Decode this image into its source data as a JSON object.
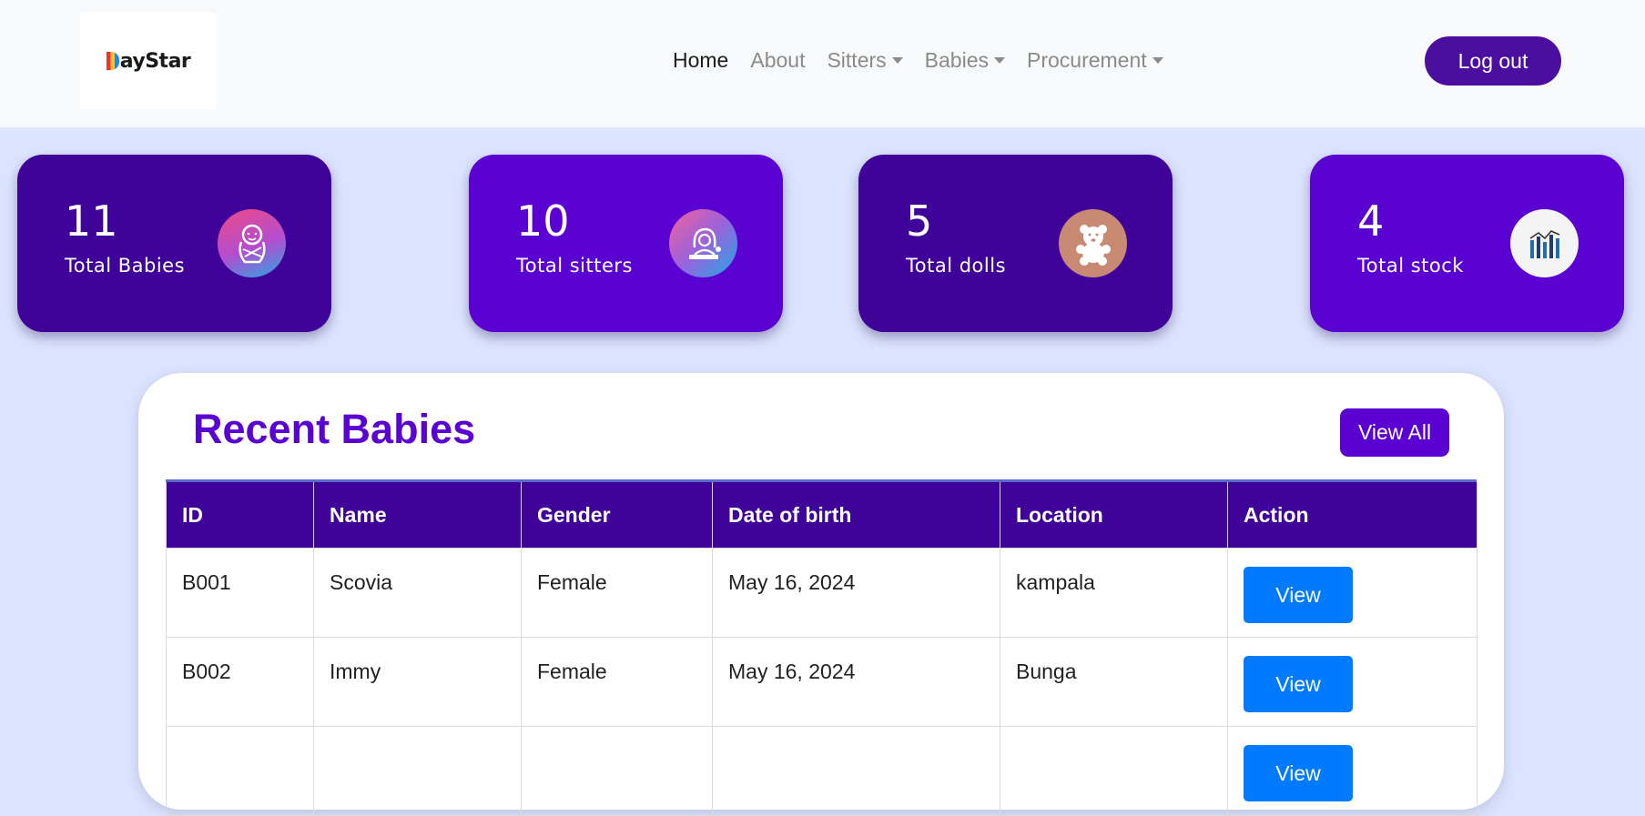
{
  "brand": {
    "logo_text": "ayStar"
  },
  "nav": {
    "items": [
      {
        "label": "Home",
        "active": true,
        "dropdown": false
      },
      {
        "label": "About",
        "active": false,
        "dropdown": false
      },
      {
        "label": "Sitters",
        "active": false,
        "dropdown": true
      },
      {
        "label": "Babies",
        "active": false,
        "dropdown": true
      },
      {
        "label": "Procurement",
        "active": false,
        "dropdown": true
      }
    ],
    "logout_label": "Log out"
  },
  "stats": [
    {
      "value": "11",
      "label": "Total Babies",
      "icon": "baby-icon"
    },
    {
      "value": "10",
      "label": "Total sitters",
      "icon": "sitter-icon"
    },
    {
      "value": "5",
      "label": "Total dolls",
      "icon": "teddy-bear-icon"
    },
    {
      "value": "4",
      "label": "Total stock",
      "icon": "bar-chart-icon"
    }
  ],
  "recent": {
    "title": "Recent Babies",
    "view_all_label": "View All",
    "columns": [
      "ID",
      "Name",
      "Gender",
      "Date of birth",
      "Location",
      "Action"
    ],
    "rows": [
      {
        "id": "B001",
        "name": "Scovia",
        "gender": "Female",
        "dob": "May 16, 2024",
        "location": "kampala",
        "action": "View"
      },
      {
        "id": "B002",
        "name": "Immy",
        "gender": "Female",
        "dob": "May 16, 2024",
        "location": "Bunga",
        "action": "View"
      },
      {
        "id": "",
        "name": "",
        "gender": "",
        "dob": "",
        "location": "",
        "action": "View"
      }
    ]
  },
  "colors": {
    "accent": "#5a02d1",
    "accent_dark": "#3f0399",
    "button_blue": "#007bff",
    "background": "#dbe3fd"
  }
}
